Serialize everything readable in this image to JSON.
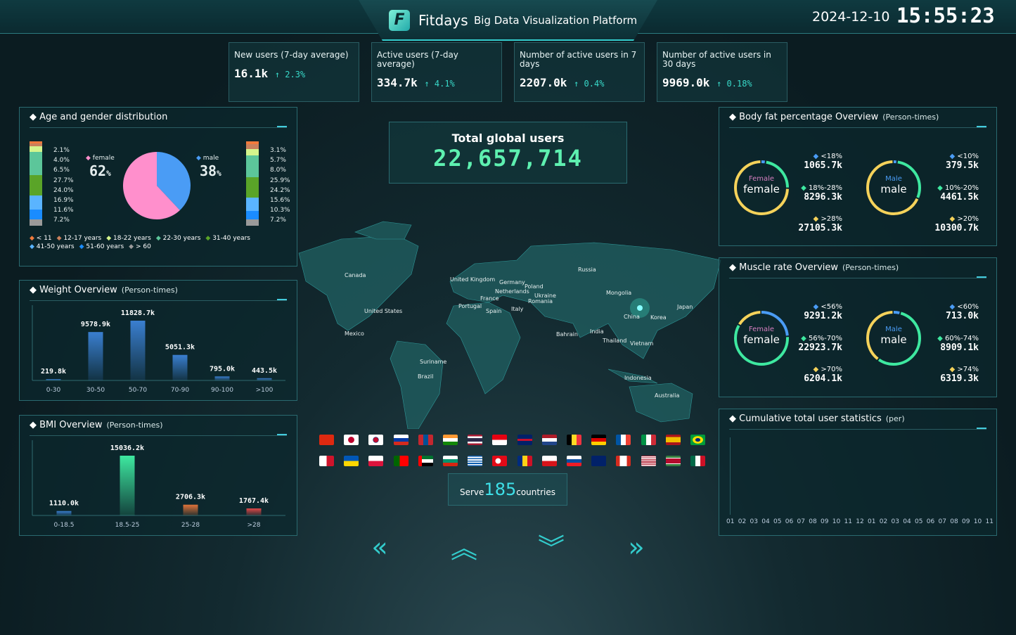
{
  "header": {
    "brand": "Fitdays",
    "subtitle": "Big Data Visualization Platform",
    "date": "2024-12-10",
    "time": "15:55:23",
    "logo_letter": "F"
  },
  "stats": [
    {
      "label": "New users (7-day average)",
      "value": "16.1k",
      "change": "↑ 2.3%"
    },
    {
      "label": "Active users (7-day average)",
      "value": "334.7k",
      "change": "↑ 4.1%"
    },
    {
      "label": "Number of active users in 7 days",
      "value": "2207.0k",
      "change": "↑ 0.4%"
    },
    {
      "label": "Number of active users in 30 days",
      "value": "9969.0k",
      "change": "↑ 0.18%"
    }
  ],
  "age_gender": {
    "title": "Age and gender distribution",
    "female": {
      "label": "female",
      "percent": "62",
      "unit": "%",
      "age_pcts": [
        "2.1%",
        "4.0%",
        "6.5%",
        "27.7%",
        "24.0%",
        "16.9%",
        "11.6%",
        "7.2%"
      ]
    },
    "male": {
      "label": "male",
      "percent": "38",
      "unit": "%",
      "age_pcts": [
        "3.1%",
        "5.7%",
        "8.0%",
        "25.9%",
        "24.2%",
        "15.6%",
        "10.3%",
        "7.2%"
      ]
    },
    "legend": [
      "< 11",
      "12-17 years",
      "18-22 years",
      "22-30 years",
      "31-40 years",
      "41-50 years",
      "51-60 years",
      "> 60"
    ],
    "colors": [
      "#f07a3c",
      "#c9805c",
      "#d4f58c",
      "#5cc69a",
      "#5aa428",
      "#5ab4ff",
      "#1a8cff",
      "#9a9a9a"
    ],
    "female_color": "#ff8fcc",
    "male_color": "#4a9cf5"
  },
  "weight": {
    "title": "Weight Overview",
    "unit": "(Person-times)",
    "categories": [
      "0-30",
      "30-50",
      "50-70",
      "70-90",
      "90-100",
      ">100"
    ],
    "values": [
      219.8,
      9578.9,
      11828.7,
      5051.3,
      795.0,
      443.5
    ],
    "labels": [
      "219.8k",
      "9578.9k",
      "11828.7k",
      "5051.3k",
      "795.0k",
      "443.5k"
    ]
  },
  "bmi": {
    "title": "BMI Overview",
    "unit": "(Person-times)",
    "categories": [
      "0-18.5",
      "18.5-25",
      "25-28",
      ">28"
    ],
    "values": [
      1110.0,
      15036.2,
      2706.3,
      1767.4
    ],
    "labels": [
      "1110.0k",
      "15036.2k",
      "2706.3k",
      "1767.4k"
    ],
    "colors": [
      "#3a7fd0",
      "#3ee8a0",
      "#e0733a",
      "#e04848"
    ]
  },
  "total": {
    "label": "Total global users",
    "value": "22,657,714"
  },
  "map_labels": [
    "Canada",
    "United States",
    "Mexico",
    "Suriname",
    "Brazil",
    "United Kingdom",
    "Germany",
    "Poland",
    "Netherlands",
    "France",
    "Ukraine",
    "Romania",
    "Portugal",
    "Spain",
    "Italy",
    "Russia",
    "Mongolia",
    "China",
    "Korea",
    "Japan",
    "India",
    "Bahrain",
    "Thailand",
    "Vietnam",
    "Indonesia",
    "Australia"
  ],
  "flags": [
    [
      "china",
      "japan",
      "south-korea",
      "russia",
      "mongolia",
      "india",
      "thailand",
      "indonesia",
      "united-kingdom",
      "netherlands",
      "belgium",
      "germany",
      "france",
      "italy",
      "spain",
      "brazil"
    ],
    [
      "malta",
      "ukraine",
      "poland",
      "portugal",
      "uae",
      "bulgaria",
      "greece",
      "turkey",
      "romania",
      "czechia",
      "slovakia",
      "australia",
      "canada",
      "usa",
      "suriname",
      "mexico"
    ]
  ],
  "serve": {
    "prefix": "Serve",
    "count": "185",
    "suffix": "countries"
  },
  "body_fat": {
    "title": "Body fat percentage Overview",
    "unit": "(Person-times)",
    "female": {
      "tag": "Female",
      "label": "female",
      "items": [
        {
          "range": "<18%",
          "value": "1065.7k",
          "n": 1065.7
        },
        {
          "range": "18%-28%",
          "value": "8296.3k",
          "n": 8296.3
        },
        {
          "range": ">28%",
          "value": "27105.3k",
          "n": 27105.3
        }
      ]
    },
    "male": {
      "tag": "Male",
      "label": "male",
      "items": [
        {
          "range": "<10%",
          "value": "379.5k",
          "n": 379.5
        },
        {
          "range": "10%-20%",
          "value": "4461.5k",
          "n": 4461.5
        },
        {
          "range": ">20%",
          "value": "10300.7k",
          "n": 10300.7
        }
      ]
    }
  },
  "muscle": {
    "title": "Muscle rate Overview",
    "unit": "(Person-times)",
    "female": {
      "tag": "Female",
      "label": "female",
      "items": [
        {
          "range": "<56%",
          "value": "9291.2k",
          "n": 9291.2
        },
        {
          "range": "56%-70%",
          "value": "22923.7k",
          "n": 22923.7
        },
        {
          "range": ">70%",
          "value": "6204.1k",
          "n": 6204.1
        }
      ]
    },
    "male": {
      "tag": "Male",
      "label": "male",
      "items": [
        {
          "range": "<60%",
          "value": "713.0k",
          "n": 713.0
        },
        {
          "range": "60%-74%",
          "value": "8909.1k",
          "n": 8909.1
        },
        {
          "range": ">74%",
          "value": "6319.3k",
          "n": 6319.3
        }
      ]
    }
  },
  "ring_colors": [
    "#4a9cf5",
    "#3ee8a0",
    "#f5d25a"
  ],
  "cumulative": {
    "title": "Cumulative total user statistics",
    "unit": "(per)",
    "months": [
      "01",
      "02",
      "03",
      "04",
      "05",
      "06",
      "07",
      "08",
      "09",
      "10",
      "11",
      "12",
      "01",
      "02",
      "03",
      "04",
      "05",
      "06",
      "07",
      "08",
      "09",
      "10",
      "11"
    ]
  },
  "nav": [
    "chevrons-left-icon",
    "chevrons-up-icon",
    "chevrons-down-icon",
    "chevrons-right-icon"
  ]
}
